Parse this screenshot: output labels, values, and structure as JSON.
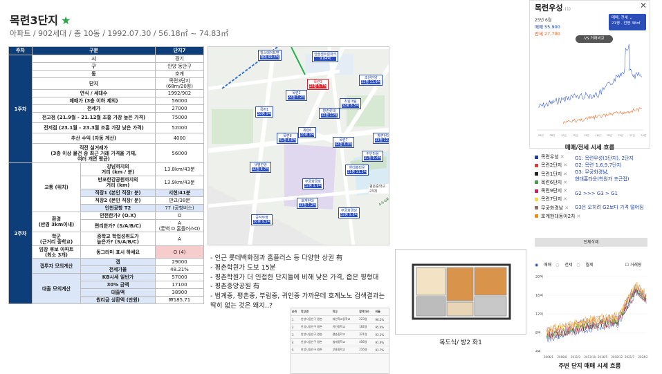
{
  "header": {
    "title": "목련3단지",
    "star": "★",
    "subtitle": "아파트 / 902세대 / 총 10동 / 1992.07.30 / 56.18㎡ ~ 74.83㎡"
  },
  "table": {
    "col_week": "주차",
    "col_category": "구분",
    "col_complex": "단지7",
    "week1": "1주차",
    "week2": "2주차",
    "rows1": [
      [
        "시",
        "경기"
      ],
      [
        "구",
        "안양 동안구"
      ],
      [
        "동",
        "호계"
      ],
      [
        "단지",
        "목련3단지\n(68m/20평)"
      ],
      [
        "연식 / 세대수",
        "1992/902"
      ],
      [
        "매매가 (3층 이하 제외)",
        "56000"
      ],
      [
        "전세가",
        "27000"
      ],
      [
        "전고점 (21.9월 - 21.12월 조흥 가장 높은 가격)",
        "75000"
      ],
      [
        "전저점 (23.1월 - 23.3월 조흥 가장 낮은 가격)",
        "52000"
      ],
      [
        "추산 수익 (자동 계산)",
        "4000"
      ],
      [
        "직전 실거래가\n(3층 이상 물건 중 최근 거래 가격을 기재,\n여러 개면 평균)",
        "56000"
      ]
    ],
    "transport_label": "교통 (위치)",
    "transport": [
      [
        "강남까지의\n거리 (km / 분)",
        "13.8km/43분"
      ],
      [
        "반포한강공원까지의\n거리 (km)",
        "13.9km/43분"
      ],
      [
        "직장1 (본인 직장/ 분)",
        "서현/41분"
      ],
      [
        "직장2 (본인 직장/ 분)",
        "판교/38분"
      ],
      [
        "인천공항 T2",
        "77 (공항버스)"
      ]
    ],
    "env_label": "환경\n(반경 3km이내)",
    "env": [
      [
        "안전한가? (O.X)",
        "O"
      ],
      [
        "편리한가? (S/A/B/C)",
        "A\n(롯백 O 홈플러스O)"
      ]
    ],
    "school_label": "학군\n(근거리 중학교)",
    "school_q": "중학교 학업성취도가\n높은가? (S/A/B/C)",
    "school_v": "A",
    "cand_label": "임장 후보 아파트\n(최소 3개)",
    "cand_q": "동그라미 표시 하세요",
    "cand_v": "O (4)",
    "gap_label": "갭투자 모의계산",
    "gap": [
      [
        "갭",
        "29000"
      ],
      [
        "전세가율",
        "48.21%"
      ]
    ],
    "loan_label": "대출 모의계산",
    "loan": [
      [
        "KB시세 일반가",
        "57000"
      ],
      [
        "30% 금액",
        "17100"
      ],
      [
        "대출액",
        "38900"
      ],
      [
        "원리금 상환액 (만원)",
        "₩185.71"
      ]
    ]
  },
  "map": {
    "markers": [
      {
        "name": "힐스테이트펜",
        "price": "매매 69.4억"
      },
      {
        "name": "한솔센트럴파크",
        "price": "9.84억"
      },
      {
        "name": "목련3",
        "price": "23평 5.7억",
        "red": true
      },
      {
        "name": "목련2",
        "price": "22평 7.2억"
      },
      {
        "name": "목련1",
        "price": "38평 9억"
      },
      {
        "name": "향촌롯데",
        "price": "32평 11억"
      },
      {
        "name": "초원대림",
        "price": "32평 8.5억"
      },
      {
        "name": "초원한양",
        "price": "32평 11.9억"
      },
      {
        "name": "귀인마을",
        "price": "31평 9.4억"
      },
      {
        "name": "목련6",
        "price": "38평 9억"
      },
      {
        "name": "목련8",
        "price": "41평 8.6억"
      },
      {
        "name": "목련7",
        "price": "42평 8.3억"
      },
      {
        "name": "향촌현대4",
        "price": "33평 12.3억"
      },
      {
        "name": "현대홈타운",
        "price": "31평 11.5억"
      },
      {
        "name": "무궁화금호",
        "price": "32평 9.9억"
      },
      {
        "name": "호계현대",
        "price": "33평 7.2억"
      },
      {
        "name": "샛별한양",
        "price": "32평 8.7억"
      },
      {
        "name": "무궁화경남",
        "price": "32평 9.8억"
      },
      {
        "name": "공작부영",
        "price": "30평 9.5억"
      }
    ],
    "area_label": "평촌중학교 23계"
  },
  "notes": [
    "- 인근 롯데백화점과 홈플러스 등 다양한 상권 有",
    "- 평촌학원가 도보 15분",
    "- 평촌학원가 더 인접한 단지들에 비해 낮은 가격, 좁은 평형대",
    "- 평촌중앙공원 有",
    "- 범계중, 평촌중, 부림중, 귀인중 가까운데 호계노노 검색결과는",
    "딱히 없는 것은 왜지..?"
  ],
  "minitable": {
    "headers": [
      "순위",
      "학교명",
      "학교",
      "합격자수",
      "비율"
    ],
    "rows": [
      [
        "1",
        "안양시동안구 평촌",
        "대안학교중학교",
        "223명",
        "96.2%"
      ],
      [
        "2",
        "안양시동안구 평촌",
        "귀인중학교",
        "182명",
        "95.4%"
      ],
      [
        "3",
        "안양시동안구 평촌",
        "평촌중학교",
        "321명",
        "93.1%"
      ],
      [
        "4",
        "안양시동안구 평촌",
        "범계중학교",
        "456명",
        "91.9%"
      ],
      [
        "5",
        "안양시동안구 평촌",
        "부흥중학교",
        "216명",
        "91.7%"
      ]
    ]
  },
  "floorplan": {
    "caption": "복도식/ 방2 화1"
  },
  "right": {
    "title": "목련우성",
    "count": "(1)",
    "close": "✕",
    "date": "25년 6월",
    "sale": "매매 55,900",
    "rent": "전세 27,700",
    "select_line1": "매매, 전세 ⌄",
    "select_line2": "21평 · 전용 38㎡",
    "vs": "VS 거래비교",
    "chart1_caption": "매매/전세 시세 흐름",
    "legend": [
      {
        "label": "목련우성",
        "color": "#1d3fa8"
      },
      {
        "label": "목련2단지",
        "color": "#e53935"
      },
      {
        "label": "목련1단지",
        "color": "#222222"
      },
      {
        "label": "목련6단지",
        "color": "#43a047"
      },
      {
        "label": "목련9단지",
        "color": "#d81b60"
      },
      {
        "label": "목련7단지",
        "color": "#fdd835"
      },
      {
        "label": "무궁화경남",
        "color": "#8d6e63"
      },
      {
        "label": "호계현대동아2차",
        "color": "#fb8c00"
      }
    ],
    "note": [
      "G1: 목련우성(3단지), 2단지",
      "G2: 목련 1,6,9,7단지",
      "G3: 무궁화경남,",
      "현대홈타운(학원가 초근접)",
      "",
      "G2 >>> G3 > G1",
      "",
      "G3은 오히려 G2보다 가격 떨어짐"
    ],
    "button": "전체삭제",
    "radio": [
      "매매",
      "전세",
      "월세"
    ],
    "radio_check": "거래량",
    "chart2_caption": "주변 단지 매매 시세 흐름",
    "chart2_yticks": [
      "20억",
      "16억",
      "12억",
      "8억",
      "4억"
    ],
    "chart2_xticks": [
      "2006/1",
      "2008/8",
      "2011/3",
      "2013/10",
      "2016/5",
      "2018/12",
      "2021/7",
      "2024/2"
    ],
    "chart1_xticks": [
      "06년",
      "08년",
      "10년",
      "12년",
      "14년",
      "16년",
      "18년",
      "20년",
      "22년",
      "24년"
    ]
  }
}
